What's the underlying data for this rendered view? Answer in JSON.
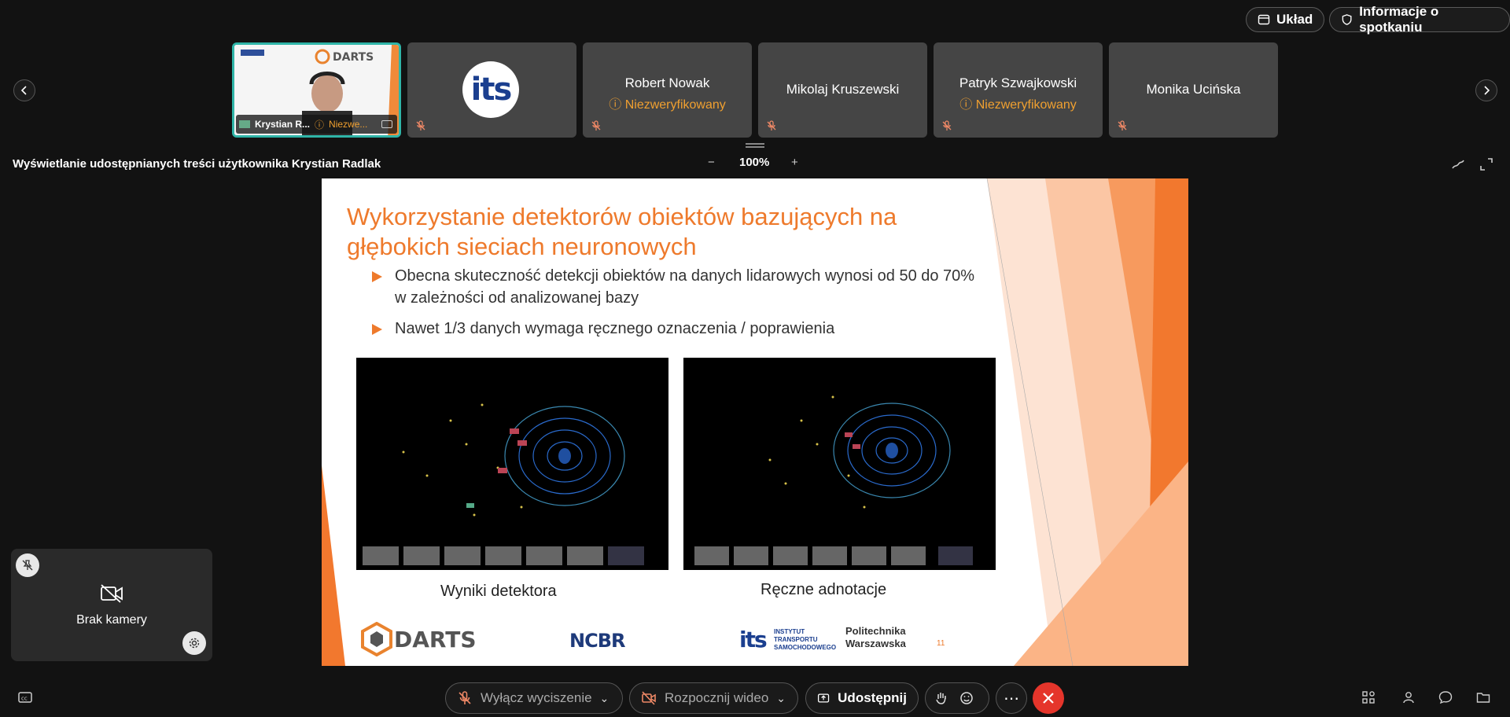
{
  "header": {
    "layout_label": "Układ",
    "meeting_info_label": "Informacje o spotkaniu"
  },
  "participants": [
    {
      "name": "Krystian R...",
      "status": "Niezwe...",
      "active": true
    },
    {
      "name": "",
      "status": "",
      "logo": "its"
    },
    {
      "name": "Robert Nowak",
      "status": "Niezweryfikowany"
    },
    {
      "name": "Mikolaj Kruszewski",
      "status": ""
    },
    {
      "name": "Patryk Szwajkowski",
      "status": "Niezweryfikowany"
    },
    {
      "name": "Monika Ucińska",
      "status": ""
    }
  ],
  "share": {
    "title": "Wyświetlanie udostępnianych treści użytkownika Krystian Radlak",
    "zoom": "100%"
  },
  "slide": {
    "title": "Wykorzystanie detektorów obiektów bazujących na głębokich sieciach neuronowych",
    "bullets": [
      "Obecna skuteczność detekcji obiektów na danych lidarowych wynosi od 50 do 70% w zależności od analizowanej bazy",
      "Nawet 1/3 danych wymaga ręcznego oznaczenia / poprawienia"
    ],
    "caption_left": "Wyniki detektora",
    "caption_right": "Ręczne adnotacje",
    "logo_darts": "DARTS",
    "logo_ncbr": "NCBR",
    "logo_its_text": "INSTYTUT TRANSPORTU SAMOCHODOWEGO",
    "logo_pw": "Politechnika Warszawska",
    "page_number": "11"
  },
  "selfview": {
    "label": "Brak kamery"
  },
  "controls": {
    "mute_label": "Wyłącz wyciszenie",
    "video_label": "Rozpocznij wideo",
    "share_label": "Udostępnij"
  },
  "colors": {
    "accent_orange": "#ee7a2c",
    "active_border": "#2fb5a8",
    "end_call": "#e5352b",
    "unverified": "#f0a030"
  }
}
